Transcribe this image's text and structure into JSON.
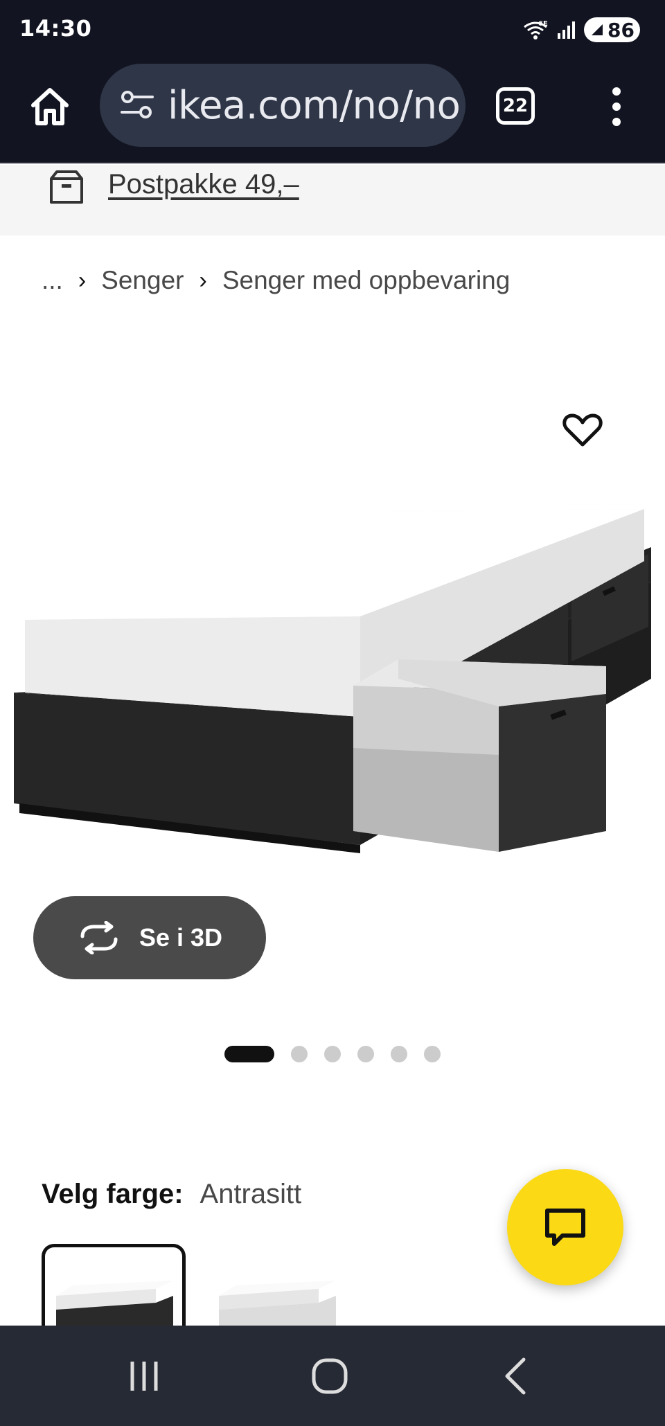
{
  "status_bar": {
    "time": "14:30",
    "network": "6E",
    "battery": "86"
  },
  "browser": {
    "url": "ikea.com/no/no",
    "tab_count": "22"
  },
  "shipping_banner": {
    "link_text": "Postpakke 49,–"
  },
  "breadcrumb": {
    "ellipsis": "...",
    "items": [
      "Senger",
      "Senger med oppbevaring"
    ]
  },
  "product": {
    "view_3d_label": "Se i 3D",
    "carousel_total": 6,
    "carousel_active_index": 0
  },
  "color_picker": {
    "label": "Velg farge:",
    "selected_value": "Antrasitt"
  },
  "colors": {
    "chat_fab": "#fbd914",
    "dark_bar": "#121521",
    "nav_bar": "#262a35"
  }
}
